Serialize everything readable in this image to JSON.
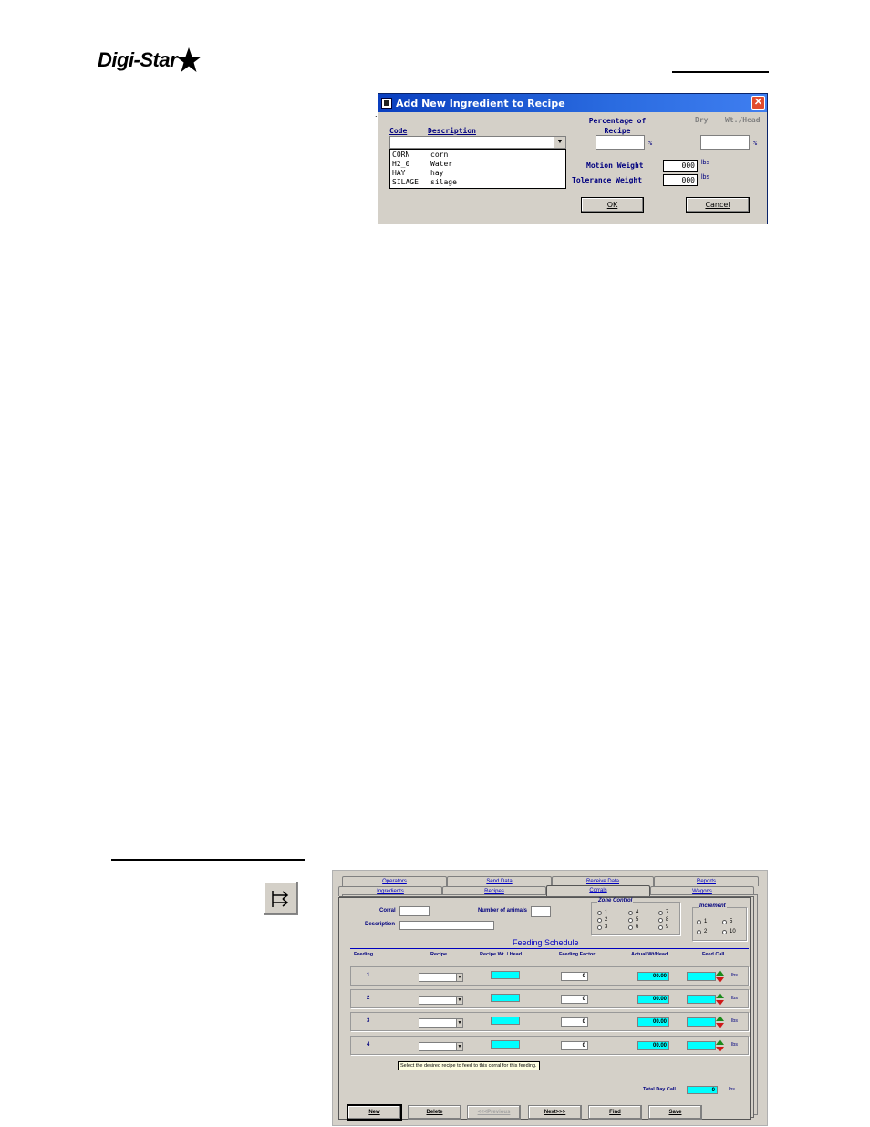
{
  "logo": {
    "text": "Digi-Star"
  },
  "dialog": {
    "title": "Add New Ingredient to Recipe",
    "code_header": "Code",
    "description_header": "Description",
    "percentage_header_line1": "Percentage of",
    "percentage_header_line2": "Recipe",
    "dry_header": "Dry",
    "wt_head_header": "Wt./Head",
    "percent_sign": "%",
    "ingredients": [
      {
        "code": "CORN",
        "description": "corn"
      },
      {
        "code": "H2_0",
        "description": "Water"
      },
      {
        "code": "HAY",
        "description": "hay"
      },
      {
        "code": "SILAGE",
        "description": "silage"
      }
    ],
    "motion_weight_label": "Motion Weight",
    "motion_weight_value": "000",
    "tolerance_weight_label": "Tolerance Weight",
    "tolerance_weight_value": "000",
    "unit": "lbs",
    "ok_label": "OK",
    "cancel_label": "Cancel"
  },
  "corrals_window": {
    "tabs_back": [
      "Operators",
      "Send Data",
      "Receive Data",
      "Reports"
    ],
    "tabs_front": [
      "Ingredients",
      "Recipes",
      "Corrals",
      "Wagons"
    ],
    "active_tab": "Corrals",
    "corral_label": "Corral",
    "animals_label": "Number of animals",
    "description_label": "Description",
    "zone_control_title": "Zone Control",
    "zone_options": [
      "1",
      "2",
      "3",
      "4",
      "5",
      "6",
      "7",
      "8",
      "9"
    ],
    "increment_title": "Increment",
    "increment_options": [
      "1",
      "2",
      "5",
      "10"
    ],
    "increment_selected": "1",
    "schedule_title": "Feeding Schedule",
    "columns": [
      "Feeding",
      "Recipe",
      "Recipe Wt. / Head",
      "Feeding Factor",
      "Actual Wt/Head",
      "Feed Call"
    ],
    "rows": [
      {
        "feeding": "1",
        "factor": "0",
        "actual": "00.00"
      },
      {
        "feeding": "2",
        "factor": "0",
        "actual": "00.00"
      },
      {
        "feeding": "3",
        "factor": "0",
        "actual": "00.00"
      },
      {
        "feeding": "4",
        "factor": "0",
        "actual": "00.00"
      }
    ],
    "unit": "lbs",
    "tooltip": "Select the desired recipe to feed to this corral for this feeding.",
    "total_label": "Total Day Call",
    "total_value": "0",
    "buttons": [
      "New",
      "Delete",
      "<<<Previous",
      "Next>>>",
      "Find",
      "Save"
    ]
  },
  "colors": {
    "titlebar": "#0a3fbf",
    "label_blue": "#00007f",
    "cyan_field": "#00ffff",
    "tab_text": "#0000c0"
  }
}
